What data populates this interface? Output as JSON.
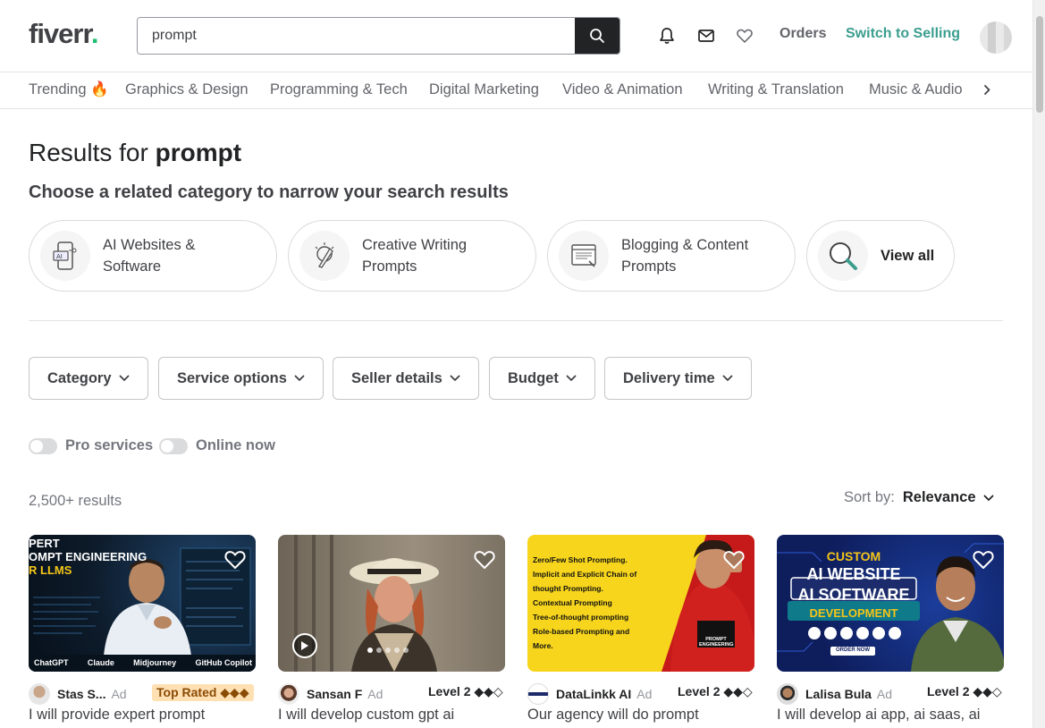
{
  "header": {
    "logo_text": "fiverr",
    "logo_dot": ".",
    "search_value": "prompt",
    "orders_label": "Orders",
    "switch_label": "Switch to Selling",
    "accent_color": "#1dbf73"
  },
  "nav": {
    "items": [
      {
        "label": "Trending 🔥"
      },
      {
        "label": "Graphics & Design"
      },
      {
        "label": "Programming & Tech"
      },
      {
        "label": "Digital Marketing"
      },
      {
        "label": "Video & Animation"
      },
      {
        "label": "Writing & Translation"
      },
      {
        "label": "Music & Audio"
      }
    ]
  },
  "results": {
    "prefix": "Results for ",
    "query": "prompt",
    "related_heading": "Choose a related category to narrow your search results",
    "count": "2,500+ results",
    "sort_label": "Sort by:",
    "sort_value": "Relevance"
  },
  "categories": [
    {
      "label_line1": "AI Websites &",
      "label_line2": "Software",
      "icon": "ai-phone-icon"
    },
    {
      "label_line1": "Creative Writing",
      "label_line2": "Prompts",
      "icon": "pen-idea-icon"
    },
    {
      "label_line1": "Blogging & Content",
      "label_line2": "Prompts",
      "icon": "document-icon"
    },
    {
      "label_line1": "View all",
      "label_line2": "",
      "icon": "magnifier-icon"
    }
  ],
  "filters": [
    {
      "label": "Category"
    },
    {
      "label": "Service options"
    },
    {
      "label": "Seller details"
    },
    {
      "label": "Budget"
    },
    {
      "label": "Delivery time"
    }
  ],
  "toggles": [
    {
      "label": "Pro services",
      "on": false
    },
    {
      "label": "Online now",
      "on": false
    }
  ],
  "gigs": [
    {
      "seller": "Stas S...",
      "ad": "Ad",
      "badge": "Top Rated ◆◆◆",
      "title": "I will provide expert prompt",
      "thumb_lines": [
        "PERT",
        "OMPT ENGINEERING",
        "R LLMS"
      ],
      "thumb_footer": [
        "ChatGPT",
        "Claude",
        "Midjourney",
        "GitHub Copilot"
      ]
    },
    {
      "seller": "Sansan F",
      "ad": "Ad",
      "badge": "Level 2 ◆◆◇",
      "title": "I will develop custom gpt ai"
    },
    {
      "seller": "DataLinkk AI",
      "ad": "Ad",
      "badge": "Level 2 ◆◆◇",
      "title": "Our agency will do prompt",
      "thumb_lines": [
        "Zero/Few Shot Prompting.",
        "Implicit and Explicit Chain of",
        "thought Prompting.",
        "Contextual Prompting",
        "Tree-of-thought prompting",
        "Role-based Prompting and",
        "More."
      ],
      "thumb_tag": "PROMPT ENGINEERING"
    },
    {
      "seller": "Lalisa Bula",
      "ad": "Ad",
      "badge": "Level 2 ◆◆◇",
      "title": "I will develop ai app, ai saas, ai",
      "thumb_lines": [
        "CUSTOM",
        "AI WEBSITE",
        "AI SOFTWARE",
        "DEVELOPMENT"
      ],
      "thumb_tag": "ORDER NOW"
    }
  ]
}
